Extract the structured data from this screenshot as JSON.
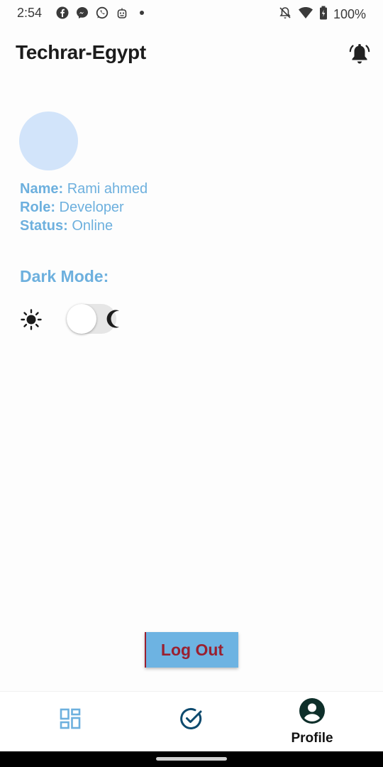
{
  "status_bar": {
    "time": "2:54",
    "battery": "100%",
    "icons": [
      "facebook-icon",
      "messenger-icon",
      "whatsapp-icon",
      "bot-icon",
      "dot-icon",
      "notifications-off-icon",
      "wifi-icon",
      "battery-charging-icon"
    ]
  },
  "app_bar": {
    "title": "Techrar-Egypt"
  },
  "profile": {
    "name_key": "Name:",
    "name_value": " Rami ahmed",
    "role_key": "Role:",
    "role_value": " Developer",
    "status_key": "Status:",
    "status_value": " Online"
  },
  "settings": {
    "dark_mode_label": "Dark Mode:",
    "dark_mode_on": false
  },
  "actions": {
    "logout_label": "Log Out"
  },
  "bottom_nav": {
    "items": [
      {
        "icon": "dashboard-icon",
        "label": ""
      },
      {
        "icon": "check-circle-icon",
        "label": ""
      },
      {
        "icon": "account-circle-icon",
        "label": "Profile"
      }
    ],
    "active_index": 2
  },
  "colors": {
    "accent": "#6db0de",
    "logout_text": "#9a2030",
    "avatar_bg": "#d2e4fa",
    "nav_icon": "#0d4a6e"
  }
}
